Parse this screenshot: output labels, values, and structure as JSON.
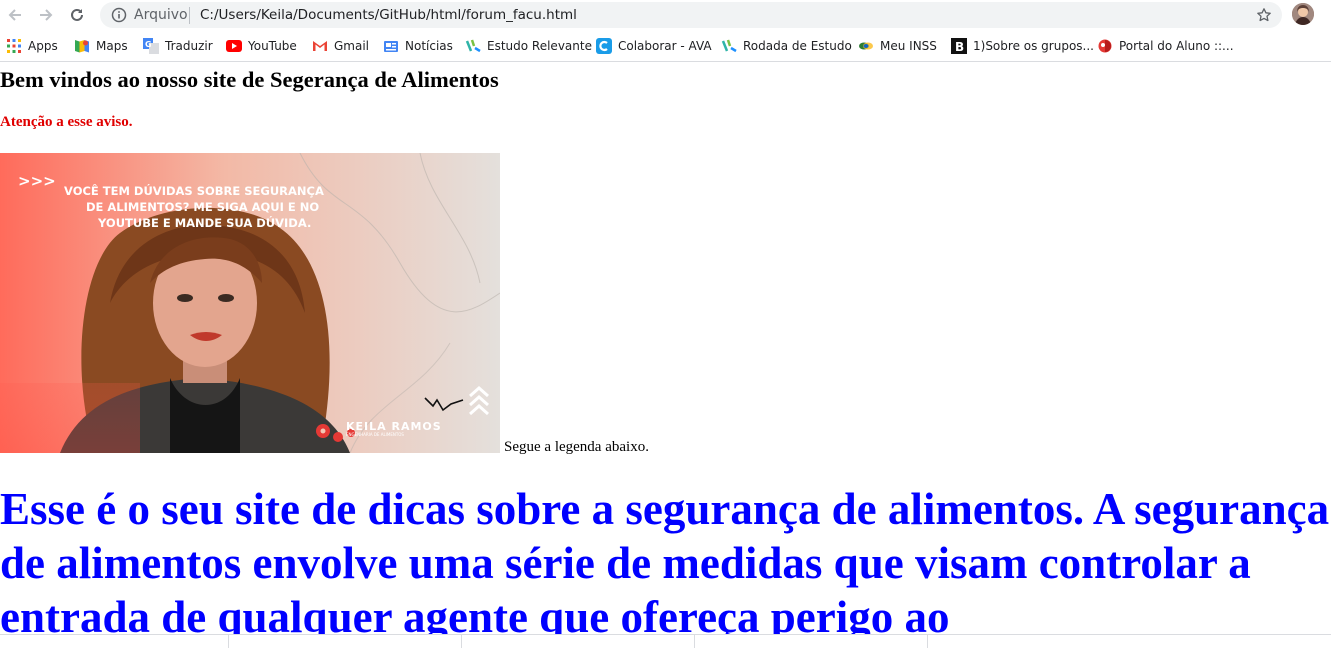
{
  "browser": {
    "scheme_label": "Arquivo",
    "url": "C:/Users/Keila/Documents/GitHub/html/forum_facu.html",
    "bookmarks": [
      {
        "label": "Apps",
        "icon": "apps-grid-icon"
      },
      {
        "label": "Maps",
        "icon": "maps-icon"
      },
      {
        "label": "Traduzir",
        "icon": "translate-icon"
      },
      {
        "label": "YouTube",
        "icon": "youtube-icon"
      },
      {
        "label": "Gmail",
        "icon": "gmail-icon"
      },
      {
        "label": "Notícias",
        "icon": "news-icon"
      },
      {
        "label": "Estudo Relevante",
        "icon": "bookmark-site-icon"
      },
      {
        "label": "Colaborar - AVA",
        "icon": "colaborar-icon"
      },
      {
        "label": "Rodada de Estudo",
        "icon": "bookmark-site-icon"
      },
      {
        "label": "Meu INSS",
        "icon": "inss-icon"
      },
      {
        "label": "1)Sobre os grupos...",
        "icon": "bold-b-icon"
      },
      {
        "label": "Portal do Aluno ::...",
        "icon": "portal-icon"
      }
    ],
    "colors": {
      "omnibox_bg": "#f1f3f4",
      "youtube": "#ff0000",
      "colaborar": "#1a9ce8"
    }
  },
  "page": {
    "heading": "Bem vindos ao nosso site de Segerança de Alimentos",
    "warning": "Atenção a esse aviso.",
    "image": {
      "headline": "VOCÊ TEM DÚVIDAS SOBRE SEGURANÇA DE ALIMENTOS? ME SIGA AQUI E NO YOUTUBE E MANDE SUA DÚVIDA.",
      "arrows": ">>>",
      "brand_name": "KEILA RAMOS",
      "brand_sub": "ENGENHARIA DE ALIMENTOS"
    },
    "image_caption": "Segue a legenda abaixo.",
    "main_text": "Esse é o seu site de dicas sobre a segurança de alimentos. A segurança de alimentos envolve uma série de medidas que visam controlar a entrada de qualquer agente que ofereça perigo ao",
    "colors": {
      "warning": "#e00000",
      "main_text": "#0000ff"
    }
  }
}
